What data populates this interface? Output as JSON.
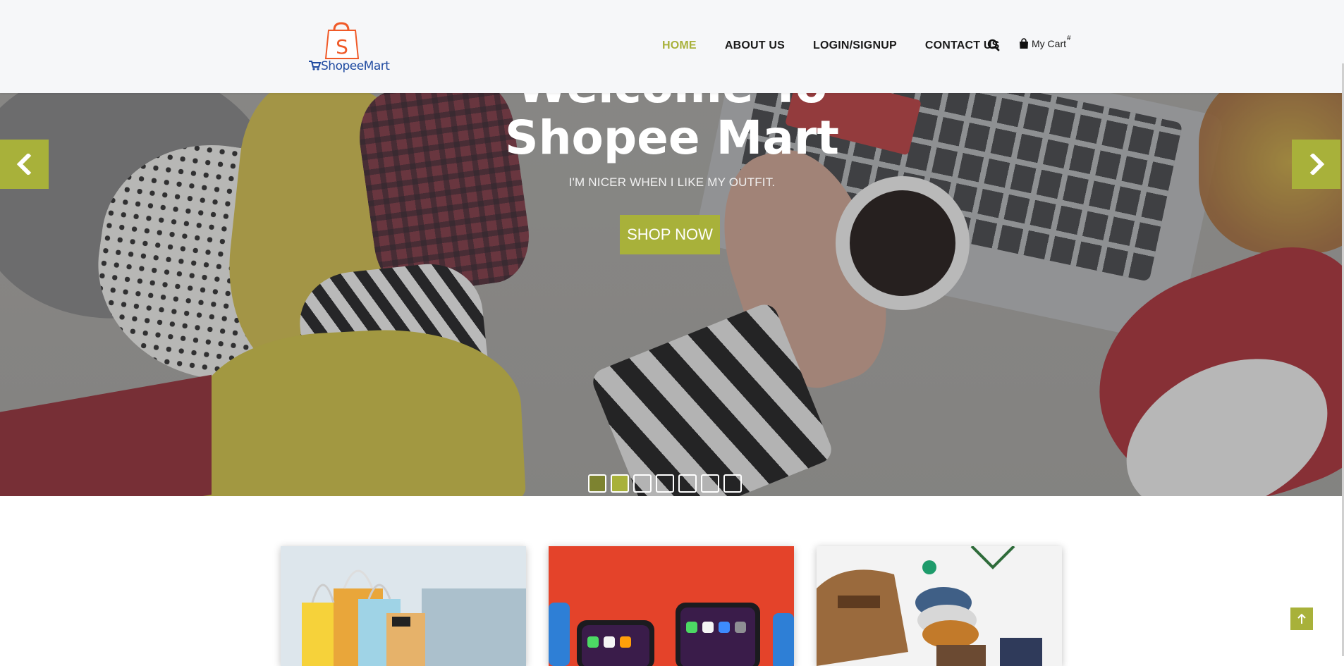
{
  "header": {
    "logo_text": "ShopeeMart",
    "logo_badge_letter": "S",
    "nav": [
      {
        "label": "HOME",
        "active": true
      },
      {
        "label": "ABOUT US",
        "active": false
      },
      {
        "label": "LOGIN/SIGNUP",
        "active": false
      },
      {
        "label": "CONTACT US",
        "active": false
      }
    ],
    "search_icon": "search-icon",
    "cart": {
      "label": "My Cart",
      "badge": "#",
      "icon": "shopping-bag-icon"
    }
  },
  "hero": {
    "title_line1": "Welcome To",
    "title_line2": "Shopee Mart",
    "subtitle": "I'M NICER WHEN I LIKE MY OUTFIT.",
    "cta_label": "SHOP NOW",
    "prev_icon": "chevron-left-icon",
    "next_icon": "chevron-right-icon",
    "slides_total": 7,
    "active_slide": 2
  },
  "products": [
    {
      "name": "shopping-bags-card"
    },
    {
      "name": "smartphones-card"
    },
    {
      "name": "winter-accessories-card"
    }
  ],
  "scroll_top_icon": "arrow-up-icon",
  "colors": {
    "accent": "#a8b13a",
    "accent_dark": "#7d8330",
    "header_bg": "#f6f7f9",
    "logo_orange": "#f05a28",
    "logo_blue": "#1f4aa0"
  }
}
